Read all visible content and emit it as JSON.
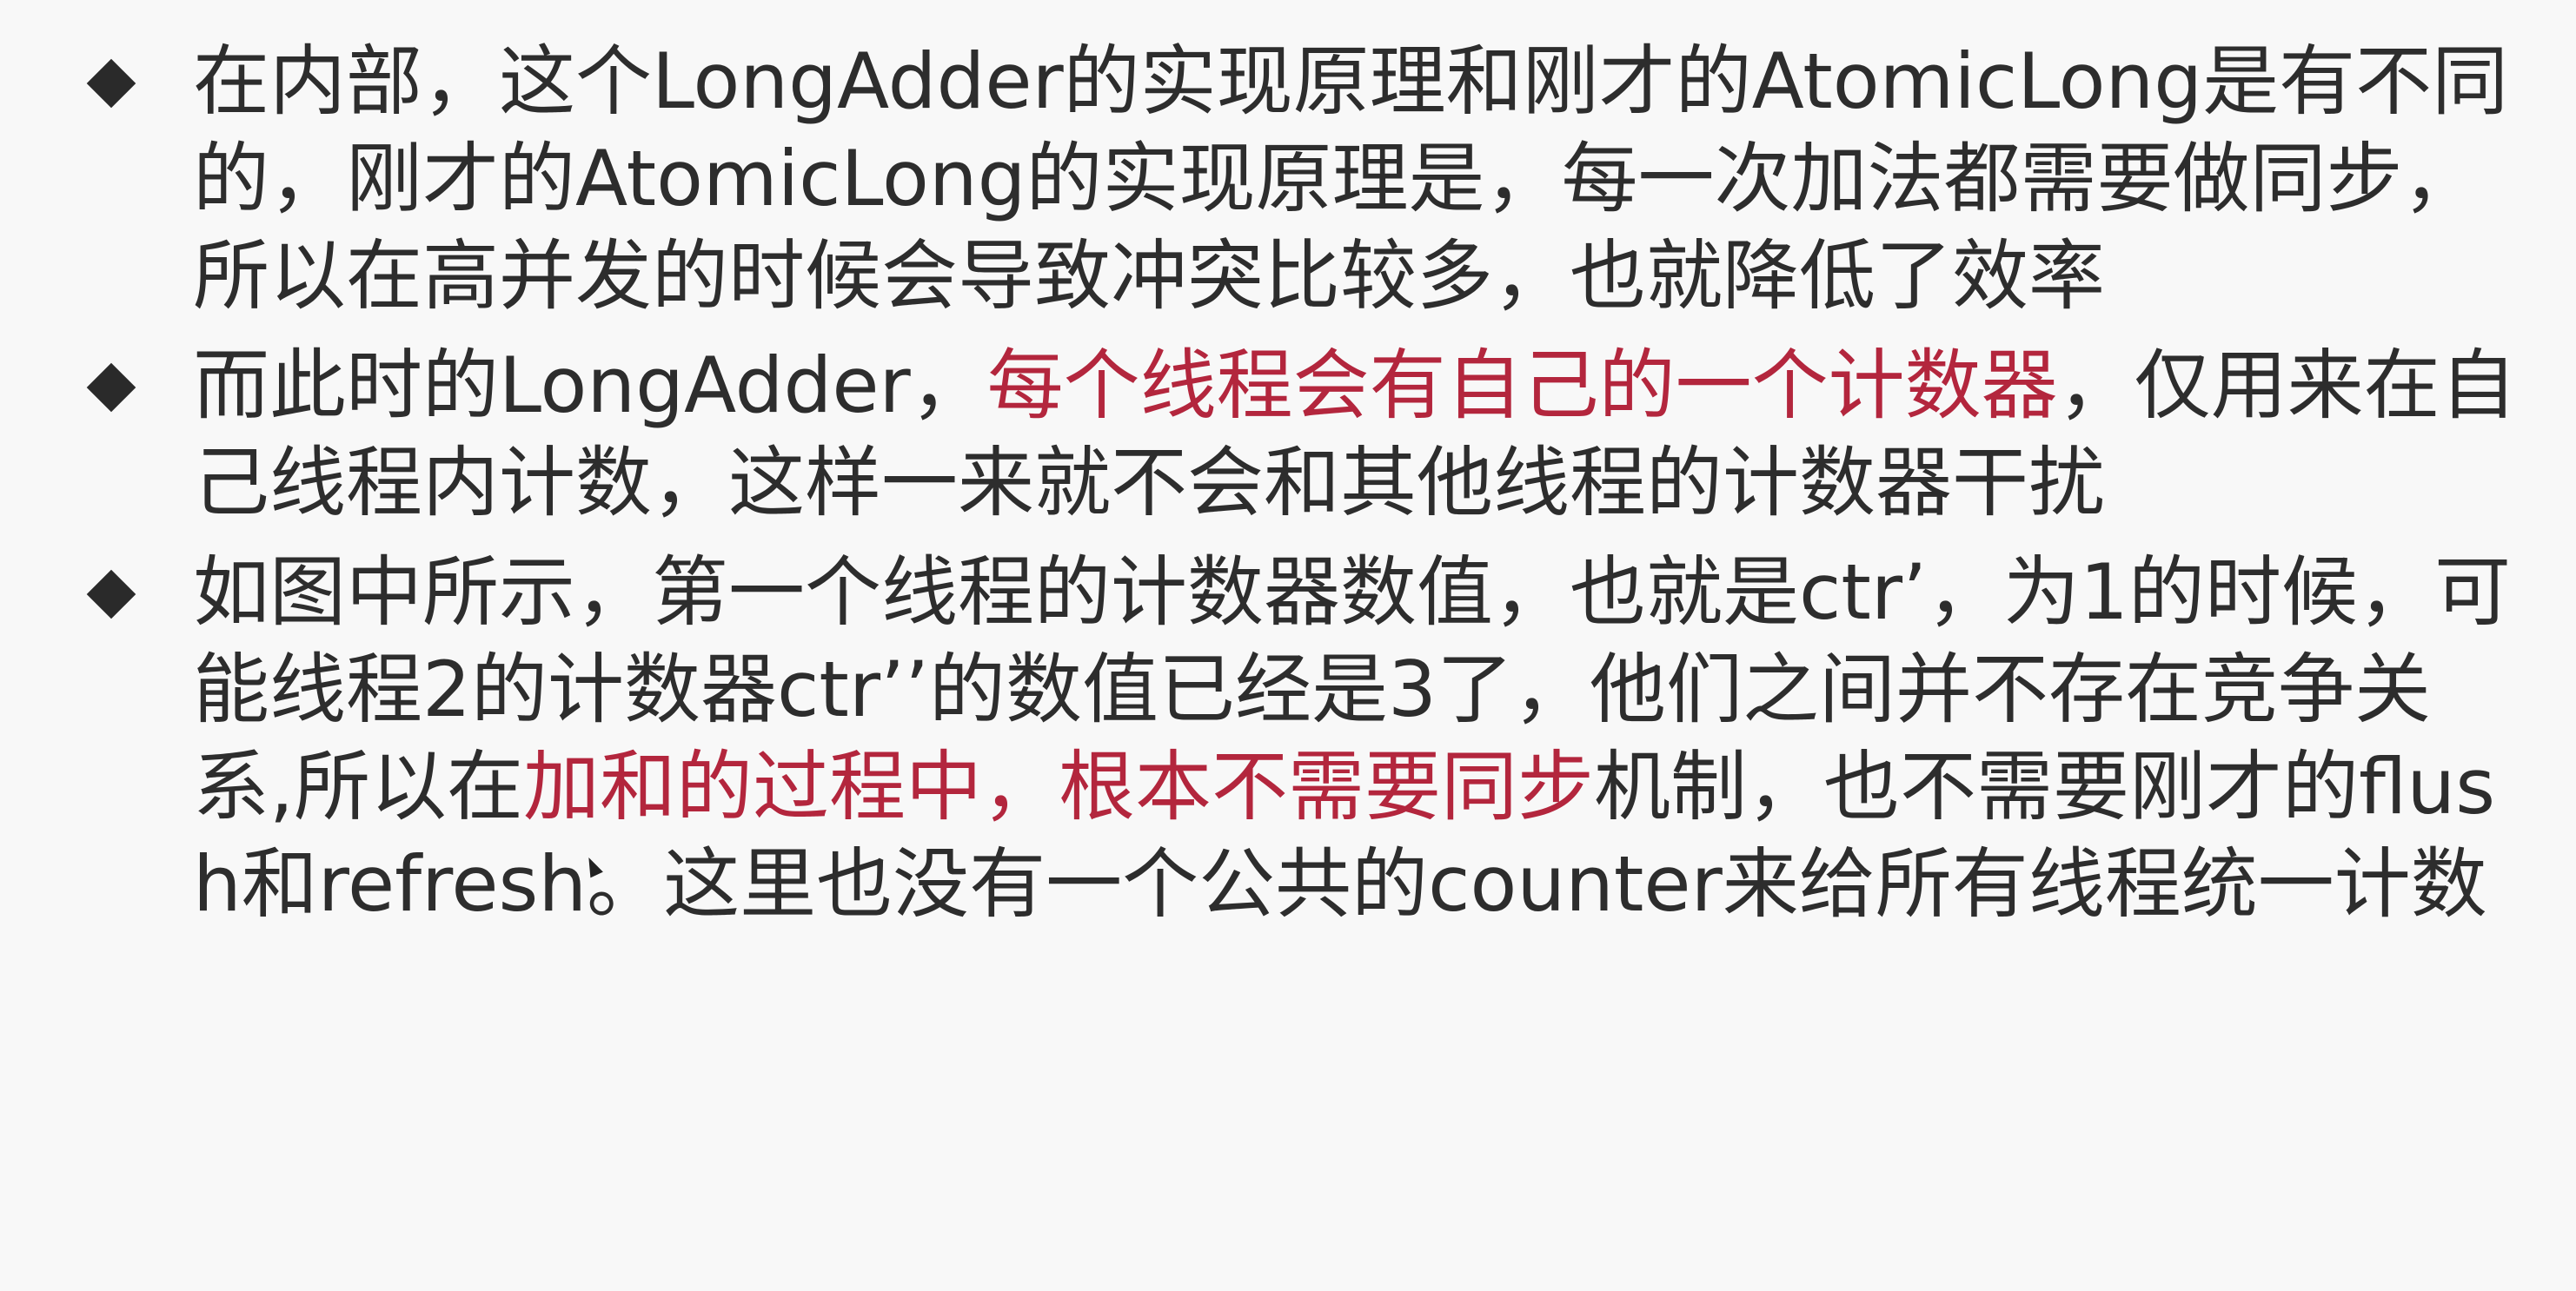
{
  "bullets": [
    {
      "segments": [
        {
          "text": "在内部，这个LongAdder的实现原理和刚才的AtomicLong是有不同的，刚才的AtomicLong的实现原理是，每一次加法都需要做同步，所以在高并发的时候会导致冲突比较多，也就降低了效率",
          "highlight": false
        }
      ]
    },
    {
      "segments": [
        {
          "text": "而此时的LongAdder，",
          "highlight": false
        },
        {
          "text": "每个线程会有自己的一个计数器",
          "highlight": true
        },
        {
          "text": "，仅用来在自己线程内计数，这样一来就不会和其他线程的计数器干扰",
          "highlight": false
        }
      ]
    },
    {
      "segments": [
        {
          "text": "如图中所示，第一个线程的计数器数值，也就是ctr’，为1的时候，可能线程2的计数器ctr’’的数值已经是3了，他们之间并不存在竞争关系,所以在",
          "highlight": false
        },
        {
          "text": "加和的过程中，根本不需要同步",
          "highlight": true
        },
        {
          "text": "机制，也不需要刚才的flush和refresh。这里也没有一个公共的counter来给所有线程统一计数",
          "highlight": false
        }
      ]
    }
  ],
  "colors": {
    "text": "#2d2d2d",
    "highlight": "#b3263d",
    "background": "#f8f8f8",
    "bullet": "#2a2a2a"
  },
  "icons": {
    "bullet": "diamond-bullet-icon",
    "cursor": "mouse-cursor-icon"
  }
}
